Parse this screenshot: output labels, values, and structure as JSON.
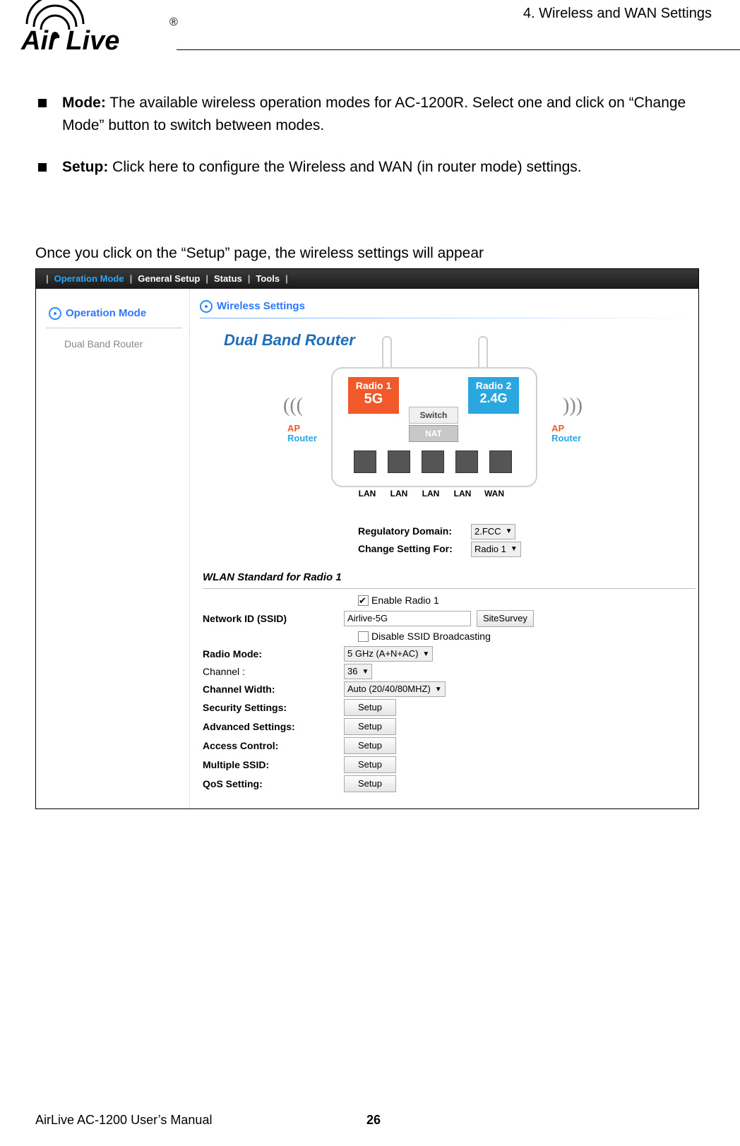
{
  "header": {
    "section_title": "4. Wireless and WAN Settings",
    "logo_text_bold": "Air Live",
    "logo_reg": "®"
  },
  "bullets": {
    "mode_lead": "Mode:",
    "mode_text": " The available wireless operation modes for AC-1200R. Select one and click on “Change Mode” button to switch between modes.",
    "setup_lead": "Setup:",
    "setup_text": "   Click here to configure the Wireless and WAN (in router mode) settings."
  },
  "lead_para": "Once you click on the “Setup” page, the wireless settings will appear",
  "nav": {
    "sep": "|",
    "op_mode": "Operation Mode",
    "general": "General Setup",
    "status": "Status",
    "tools": "Tools"
  },
  "sidebar": {
    "heading": "Operation Mode",
    "item1": "Dual Band Router"
  },
  "main": {
    "heading": "Wireless Settings",
    "title": "Dual Band Router"
  },
  "diagram": {
    "radio1_top": "Radio 1",
    "radio1_bot": "5G",
    "radio2_top": "Radio 2",
    "radio2_bot": "2.4G",
    "switch": "Switch",
    "nat": "NAT",
    "ap": "AP",
    "router": "Router",
    "lan": "LAN",
    "wan": "WAN",
    "sig_l": "(((",
    "sig_r": ")))"
  },
  "form": {
    "reg_dom_label": "Regulatory Domain:",
    "reg_dom_value": "2.FCC",
    "chg_set_label": "Change Setting For:",
    "chg_set_value": "Radio 1",
    "wlan_std": "WLAN Standard for Radio 1",
    "enable_radio": "Enable Radio 1",
    "ssid_label": "Network ID (SSID)",
    "ssid_value": "Airlive-5G",
    "site_survey": "SiteSurvey",
    "disable_bcast": "Disable SSID Broadcasting",
    "radio_mode_label": "Radio Mode:",
    "radio_mode_value": "5 GHz (A+N+AC)",
    "channel_label": "Channel :",
    "channel_value": "36",
    "ch_width_label": "Channel Width:",
    "ch_width_value": "Auto (20/40/80MHZ)",
    "sec_label": "Security Settings:",
    "adv_label": "Advanced Settings:",
    "acc_label": "Access Control:",
    "mssid_label": "Multiple SSID:",
    "qos_label": "QoS Setting:",
    "setup_btn": "Setup"
  },
  "footer": {
    "manual": "AirLive AC-1200 User’s Manual",
    "page": "26"
  }
}
